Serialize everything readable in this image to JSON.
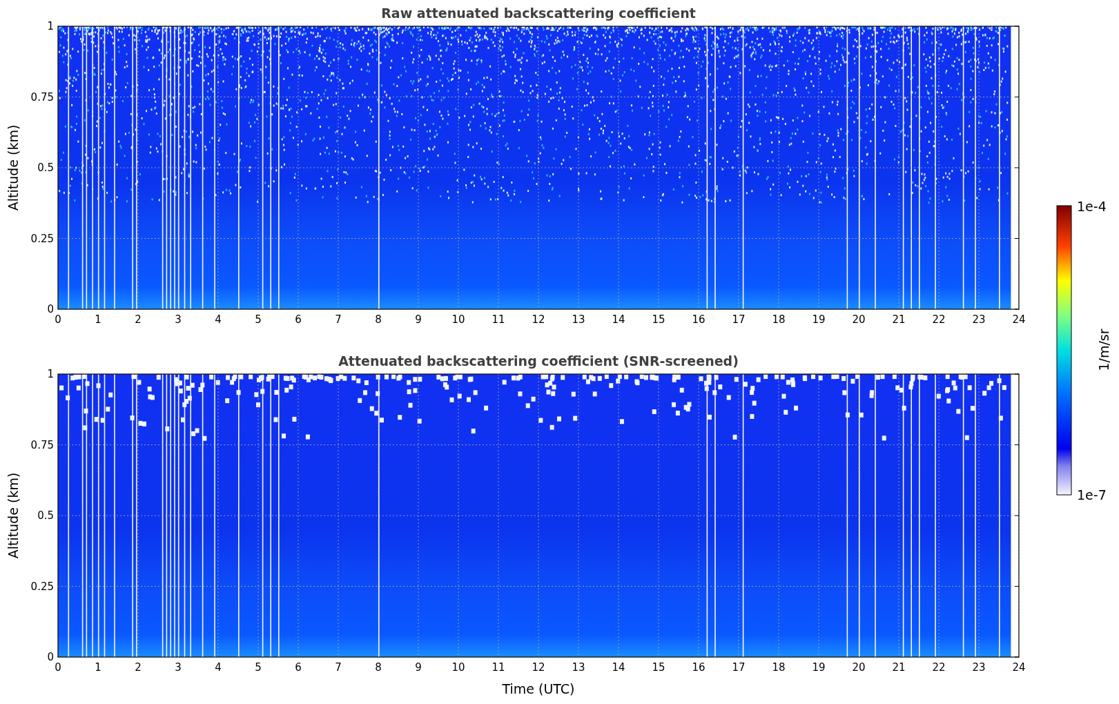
{
  "panels": [
    {
      "kind": "raw",
      "title": "Raw attenuated backscattering coefficient",
      "ylabel": "Altitude (km)",
      "y_ticks": [
        "1",
        "0.75",
        "0.5",
        "0.25",
        "0"
      ],
      "x_ticks": [
        "0",
        "1",
        "2",
        "3",
        "4",
        "5",
        "6",
        "7",
        "8",
        "9",
        "10",
        "11",
        "12",
        "13",
        "14",
        "15",
        "16",
        "17",
        "18",
        "19",
        "20",
        "21",
        "22",
        "23",
        "24"
      ]
    },
    {
      "kind": "screened",
      "title": "Attenuated backscattering coefficient (SNR-screened)",
      "ylabel": "Altitude (km)",
      "y_ticks": [
        "1",
        "0.75",
        "0.5",
        "0.25",
        "0"
      ],
      "x_ticks": [
        "0",
        "1",
        "2",
        "3",
        "4",
        "5",
        "6",
        "7",
        "8",
        "9",
        "10",
        "11",
        "12",
        "13",
        "14",
        "15",
        "16",
        "17",
        "18",
        "19",
        "20",
        "21",
        "22",
        "23",
        "24"
      ]
    }
  ],
  "xlabel": "Time (UTC)",
  "colorbar": {
    "max_label": "1e-4",
    "min_label": "1e-7",
    "unit": "1/m/sr"
  }
}
